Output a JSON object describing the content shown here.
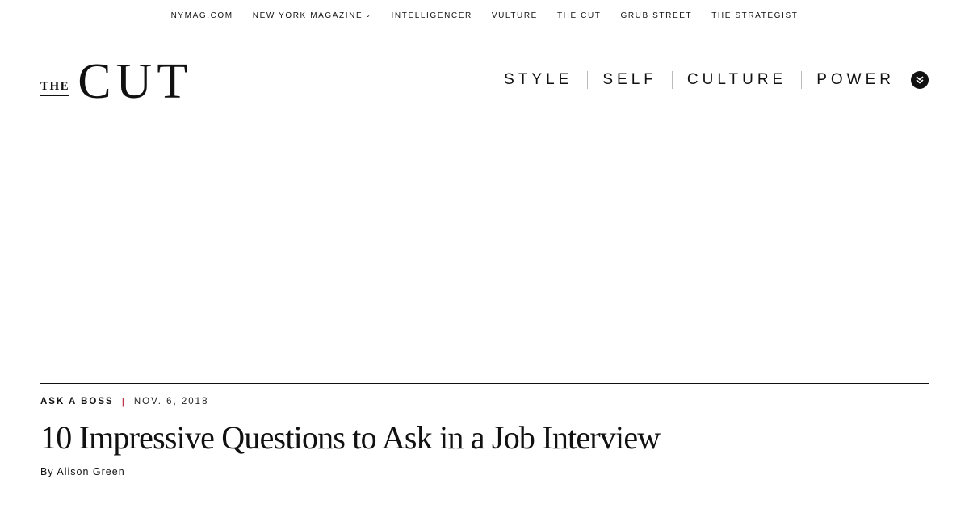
{
  "network_bar": {
    "items": [
      {
        "label": "NYMAG.COM"
      },
      {
        "label": "NEW YORK MAGAZINE",
        "has_dropdown": true
      },
      {
        "label": "INTELLIGENCER"
      },
      {
        "label": "VULTURE"
      },
      {
        "label": "THE CUT"
      },
      {
        "label": "GRUB STREET"
      },
      {
        "label": "THE STRATEGIST"
      }
    ],
    "dropdown_icon": "chevron-down-icon"
  },
  "masthead": {
    "logo_the": "THE",
    "logo_cut": "CUT",
    "nav": [
      {
        "label": "STYLE"
      },
      {
        "label": "SELF"
      },
      {
        "label": "CULTURE"
      },
      {
        "label": "POWER"
      }
    ],
    "menu_icon": "double-chevron-down-icon"
  },
  "article": {
    "rubric": "ASK A BOSS",
    "separator": "|",
    "date": "NOV. 6, 2018",
    "headline": "10 Impressive Questions to Ask in a Job Interview",
    "byline_prefix": "By",
    "author": "Alison Green"
  },
  "colors": {
    "text": "#111111",
    "accent_separator": "#b0001e",
    "rule": "#bbbbbb",
    "background": "#ffffff"
  }
}
